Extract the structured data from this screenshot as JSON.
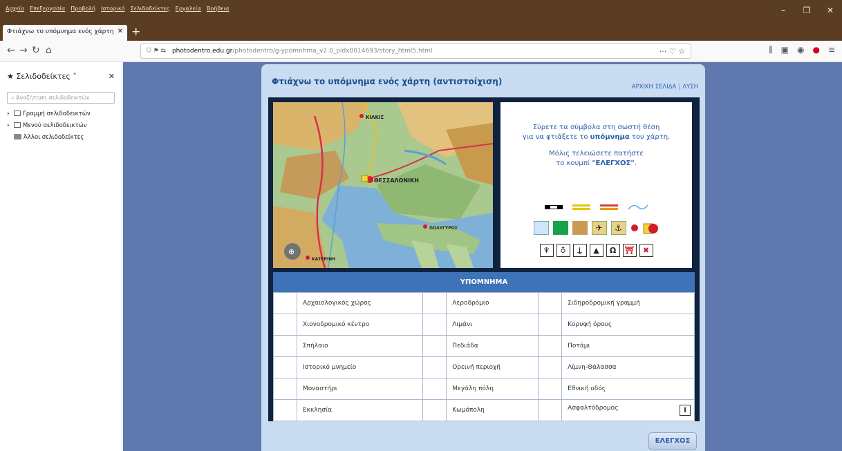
{
  "menubar": {
    "items": [
      "Αρχείο",
      "Επεξεργασία",
      "Προβολή",
      "Ιστορικό",
      "Σελιδοδείκτες",
      "Εργαλεία",
      "Βοήθεια"
    ]
  },
  "tab": {
    "title": "Φτιάχνω το υπόμνημα ενός χάρτη"
  },
  "navbar": {
    "url_domain": "photodentro.edu.gr",
    "url_path": "/photodentro/g-ypomnhma_v2.0_pidx0014693/story_html5.html"
  },
  "sidebar": {
    "title": "Σελιδοδείκτες",
    "search_placeholder": "Αναζήτηση σελιδοδεικτών",
    "items": [
      {
        "label": "Γραμμή σελιδοδεικτών"
      },
      {
        "label": "Μενού σελιδοδεικτών"
      },
      {
        "label": "Άλλοι σελιδοδείκτες"
      }
    ]
  },
  "app": {
    "title": "Φτιάχνω το υπόμνημα ενός χάρτη (αντιστοίχιση)",
    "nav_home": "ΑΡΧΙΚΗ ΣΕΛΙΔΑ",
    "nav_solution": "ΛΥΣΗ",
    "instr_line1": "Σύρετε τα σύμβολα στη σωστή θέση",
    "instr_line2_a": "για να φτιάξετε το ",
    "instr_line2_b": "υπόμνημα",
    "instr_line2_c": " του χάρτη.",
    "instr_line3": "Μόλις τελειώσετε πατήστε",
    "instr_line4_a": "το κουμπί ",
    "instr_line4_b": "\"ΕΛΕΓΧΟΣ\"",
    "instr_line4_c": ".",
    "map_labels": {
      "city": "ΘΕΣΣΑΛΟΝΙΚΗ",
      "kilkis": "ΚΙΛΚΙΣ",
      "polygyros": "ΠΟΛΥΓΥΡΟΣ",
      "katerini": "ΚΑΤΕΡΙΝΗ"
    },
    "legend_title": "ΥΠΟΜΝΗΜΑ",
    "legend_rows": [
      [
        "Αρχαιολογικός χώρος",
        "Αεροδρόμιο",
        "Σιδηροδρομική γραμμή"
      ],
      [
        "Χιονοδρομικό κέντρο",
        "Λιμάνι",
        "Κορυφή όρους"
      ],
      [
        "Σπήλαιο",
        "Πεδιάδα",
        "Ποτάμι"
      ],
      [
        "Ιστορικό μνημείο",
        "Ορεινή περιοχή",
        "Λίμνη-Θάλασσα"
      ],
      [
        "Μοναστήρι",
        "Μεγάλη πόλη",
        "Εθνική οδός"
      ],
      [
        "Εκκλησία",
        "Κωμόπολη",
        "Ασφαλτόδρομος"
      ]
    ],
    "check_button": "ΕΛΕΓΧΟΣ",
    "info_label": "i"
  },
  "colors": {
    "browser_chrome": "#5b3d23",
    "page_background": "#5f78ad",
    "panel": "#c9dcf1",
    "legend_header": "#3f73b8"
  }
}
